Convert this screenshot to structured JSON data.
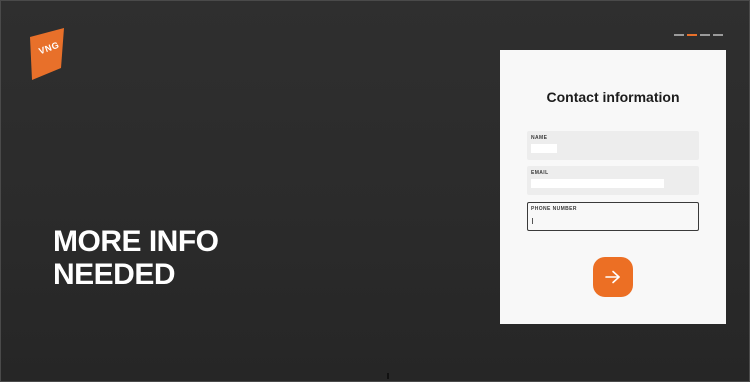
{
  "logo": {
    "text": "VNG",
    "color": "#e8702a"
  },
  "headline": {
    "line1": "MORE INFO",
    "line2": "NEEDED"
  },
  "progress": {
    "steps": 4,
    "current": 2,
    "accent": "#e8702a"
  },
  "form": {
    "title": "Contact information",
    "fields": [
      {
        "label": "NAME",
        "value": ""
      },
      {
        "label": "EMAIL",
        "value": ""
      },
      {
        "label": "PHONE NUMBER",
        "value": ""
      }
    ],
    "submit_icon": "arrow-right-icon",
    "accent": "#ec6f24"
  }
}
